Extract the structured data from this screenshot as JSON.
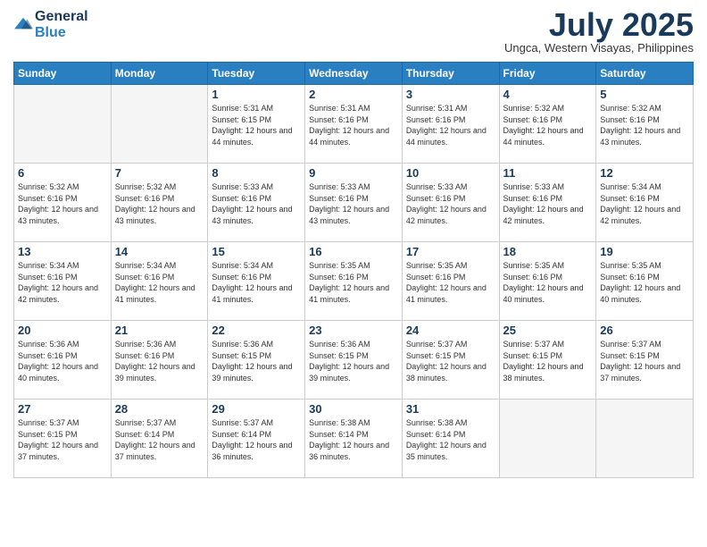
{
  "header": {
    "logo": {
      "general": "General",
      "blue": "Blue"
    },
    "title": "July 2025",
    "location": "Ungca, Western Visayas, Philippines"
  },
  "days_of_week": [
    "Sunday",
    "Monday",
    "Tuesday",
    "Wednesday",
    "Thursday",
    "Friday",
    "Saturday"
  ],
  "weeks": [
    [
      {
        "day": "",
        "empty": true
      },
      {
        "day": "",
        "empty": true
      },
      {
        "day": "1",
        "sunrise": "5:31 AM",
        "sunset": "6:15 PM",
        "daylight": "12 hours and 44 minutes."
      },
      {
        "day": "2",
        "sunrise": "5:31 AM",
        "sunset": "6:16 PM",
        "daylight": "12 hours and 44 minutes."
      },
      {
        "day": "3",
        "sunrise": "5:31 AM",
        "sunset": "6:16 PM",
        "daylight": "12 hours and 44 minutes."
      },
      {
        "day": "4",
        "sunrise": "5:32 AM",
        "sunset": "6:16 PM",
        "daylight": "12 hours and 44 minutes."
      },
      {
        "day": "5",
        "sunrise": "5:32 AM",
        "sunset": "6:16 PM",
        "daylight": "12 hours and 43 minutes."
      }
    ],
    [
      {
        "day": "6",
        "sunrise": "5:32 AM",
        "sunset": "6:16 PM",
        "daylight": "12 hours and 43 minutes."
      },
      {
        "day": "7",
        "sunrise": "5:32 AM",
        "sunset": "6:16 PM",
        "daylight": "12 hours and 43 minutes."
      },
      {
        "day": "8",
        "sunrise": "5:33 AM",
        "sunset": "6:16 PM",
        "daylight": "12 hours and 43 minutes."
      },
      {
        "day": "9",
        "sunrise": "5:33 AM",
        "sunset": "6:16 PM",
        "daylight": "12 hours and 43 minutes."
      },
      {
        "day": "10",
        "sunrise": "5:33 AM",
        "sunset": "6:16 PM",
        "daylight": "12 hours and 42 minutes."
      },
      {
        "day": "11",
        "sunrise": "5:33 AM",
        "sunset": "6:16 PM",
        "daylight": "12 hours and 42 minutes."
      },
      {
        "day": "12",
        "sunrise": "5:34 AM",
        "sunset": "6:16 PM",
        "daylight": "12 hours and 42 minutes."
      }
    ],
    [
      {
        "day": "13",
        "sunrise": "5:34 AM",
        "sunset": "6:16 PM",
        "daylight": "12 hours and 42 minutes."
      },
      {
        "day": "14",
        "sunrise": "5:34 AM",
        "sunset": "6:16 PM",
        "daylight": "12 hours and 41 minutes."
      },
      {
        "day": "15",
        "sunrise": "5:34 AM",
        "sunset": "6:16 PM",
        "daylight": "12 hours and 41 minutes."
      },
      {
        "day": "16",
        "sunrise": "5:35 AM",
        "sunset": "6:16 PM",
        "daylight": "12 hours and 41 minutes."
      },
      {
        "day": "17",
        "sunrise": "5:35 AM",
        "sunset": "6:16 PM",
        "daylight": "12 hours and 41 minutes."
      },
      {
        "day": "18",
        "sunrise": "5:35 AM",
        "sunset": "6:16 PM",
        "daylight": "12 hours and 40 minutes."
      },
      {
        "day": "19",
        "sunrise": "5:35 AM",
        "sunset": "6:16 PM",
        "daylight": "12 hours and 40 minutes."
      }
    ],
    [
      {
        "day": "20",
        "sunrise": "5:36 AM",
        "sunset": "6:16 PM",
        "daylight": "12 hours and 40 minutes."
      },
      {
        "day": "21",
        "sunrise": "5:36 AM",
        "sunset": "6:16 PM",
        "daylight": "12 hours and 39 minutes."
      },
      {
        "day": "22",
        "sunrise": "5:36 AM",
        "sunset": "6:15 PM",
        "daylight": "12 hours and 39 minutes."
      },
      {
        "day": "23",
        "sunrise": "5:36 AM",
        "sunset": "6:15 PM",
        "daylight": "12 hours and 39 minutes."
      },
      {
        "day": "24",
        "sunrise": "5:37 AM",
        "sunset": "6:15 PM",
        "daylight": "12 hours and 38 minutes."
      },
      {
        "day": "25",
        "sunrise": "5:37 AM",
        "sunset": "6:15 PM",
        "daylight": "12 hours and 38 minutes."
      },
      {
        "day": "26",
        "sunrise": "5:37 AM",
        "sunset": "6:15 PM",
        "daylight": "12 hours and 37 minutes."
      }
    ],
    [
      {
        "day": "27",
        "sunrise": "5:37 AM",
        "sunset": "6:15 PM",
        "daylight": "12 hours and 37 minutes."
      },
      {
        "day": "28",
        "sunrise": "5:37 AM",
        "sunset": "6:14 PM",
        "daylight": "12 hours and 37 minutes."
      },
      {
        "day": "29",
        "sunrise": "5:37 AM",
        "sunset": "6:14 PM",
        "daylight": "12 hours and 36 minutes."
      },
      {
        "day": "30",
        "sunrise": "5:38 AM",
        "sunset": "6:14 PM",
        "daylight": "12 hours and 36 minutes."
      },
      {
        "day": "31",
        "sunrise": "5:38 AM",
        "sunset": "6:14 PM",
        "daylight": "12 hours and 35 minutes."
      },
      {
        "day": "",
        "empty": true
      },
      {
        "day": "",
        "empty": true
      }
    ]
  ]
}
